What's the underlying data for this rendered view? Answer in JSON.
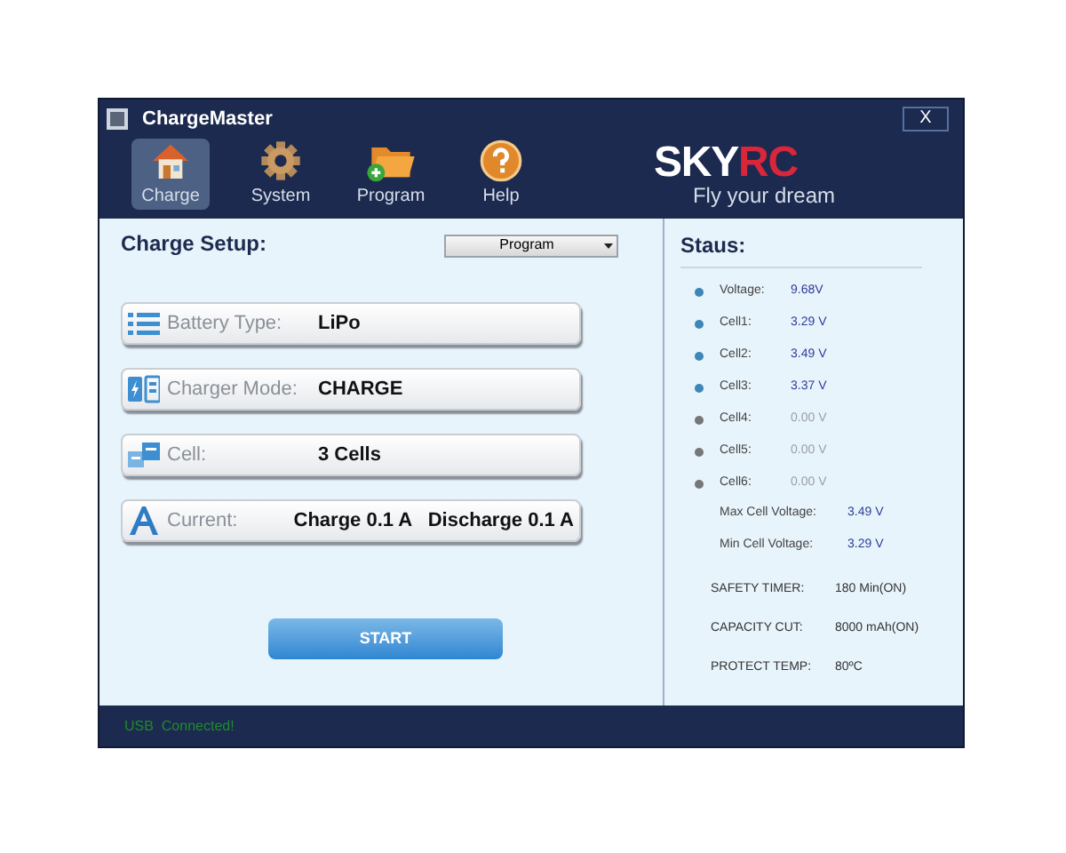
{
  "window": {
    "title": "ChargeMaster",
    "close_label": "X"
  },
  "toolbar": [
    {
      "label": "Charge",
      "kind": "house",
      "selected": true
    },
    {
      "label": "System",
      "kind": "gear",
      "selected": false
    },
    {
      "label": "Program",
      "kind": "folder",
      "selected": false
    },
    {
      "label": "Help",
      "kind": "help",
      "selected": false
    }
  ],
  "logo": {
    "brand_first": "SKY",
    "brand_second": "RC",
    "tagline": "Fly your dream"
  },
  "setup": {
    "title": "Charge Setup:",
    "dropdown": "Program",
    "rows": [
      {
        "kind": "list",
        "label": "Battery Type:",
        "value": "LiPo"
      },
      {
        "kind": "battery",
        "label": "Charger Mode:",
        "value": "CHARGE"
      },
      {
        "kind": "cells",
        "label": "Cell:",
        "value": "3 Cells"
      },
      {
        "kind": "current",
        "label": "Current:",
        "value": "Charge 0.1 A   Discharge 0.1 A"
      }
    ],
    "start_button": "START"
  },
  "status": {
    "title": "Staus:",
    "readings": [
      {
        "label": "Voltage:",
        "value": "9.68V",
        "active": true
      },
      {
        "label": "Cell1:",
        "value": "3.29 V",
        "active": true
      },
      {
        "label": "Cell2:",
        "value": "3.49 V",
        "active": true
      },
      {
        "label": "Cell3:",
        "value": "3.37 V",
        "active": true
      },
      {
        "label": "Cell4:",
        "value": "0.00 V",
        "active": false
      },
      {
        "label": "Cell5:",
        "value": "0.00 V",
        "active": false
      },
      {
        "label": "Cell6:",
        "value": "0.00 V",
        "active": false
      }
    ],
    "extremes": [
      {
        "label": "Max Cell Voltage:",
        "value": "3.49 V"
      },
      {
        "label": "Min Cell Voltage:",
        "value": "3.29 V"
      }
    ],
    "settings": [
      {
        "label": "SAFETY TIMER:",
        "value": "180 Min(ON)"
      },
      {
        "label": "CAPACITY CUT:",
        "value": "8000 mAh(ON)"
      },
      {
        "label": "PROTECT TEMP:",
        "value": "80ºC"
      }
    ]
  },
  "status_bar": "USB  Connected!"
}
